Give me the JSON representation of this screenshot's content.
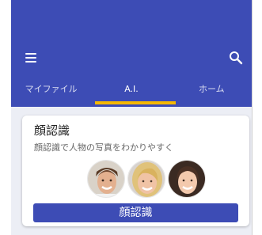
{
  "tabs": [
    {
      "label": "マイファイル"
    },
    {
      "label": "A.I."
    },
    {
      "label": "ホーム"
    }
  ],
  "card": {
    "title": "顔認識",
    "subtitle": "顔認識で人物の写真をわかりやすく",
    "button_label": "顔認識"
  },
  "colors": {
    "primary": "#3d4cb5",
    "indicator": "#f6b800",
    "background": "#eceef5"
  },
  "icons": [
    "menu-icon",
    "search-icon"
  ]
}
